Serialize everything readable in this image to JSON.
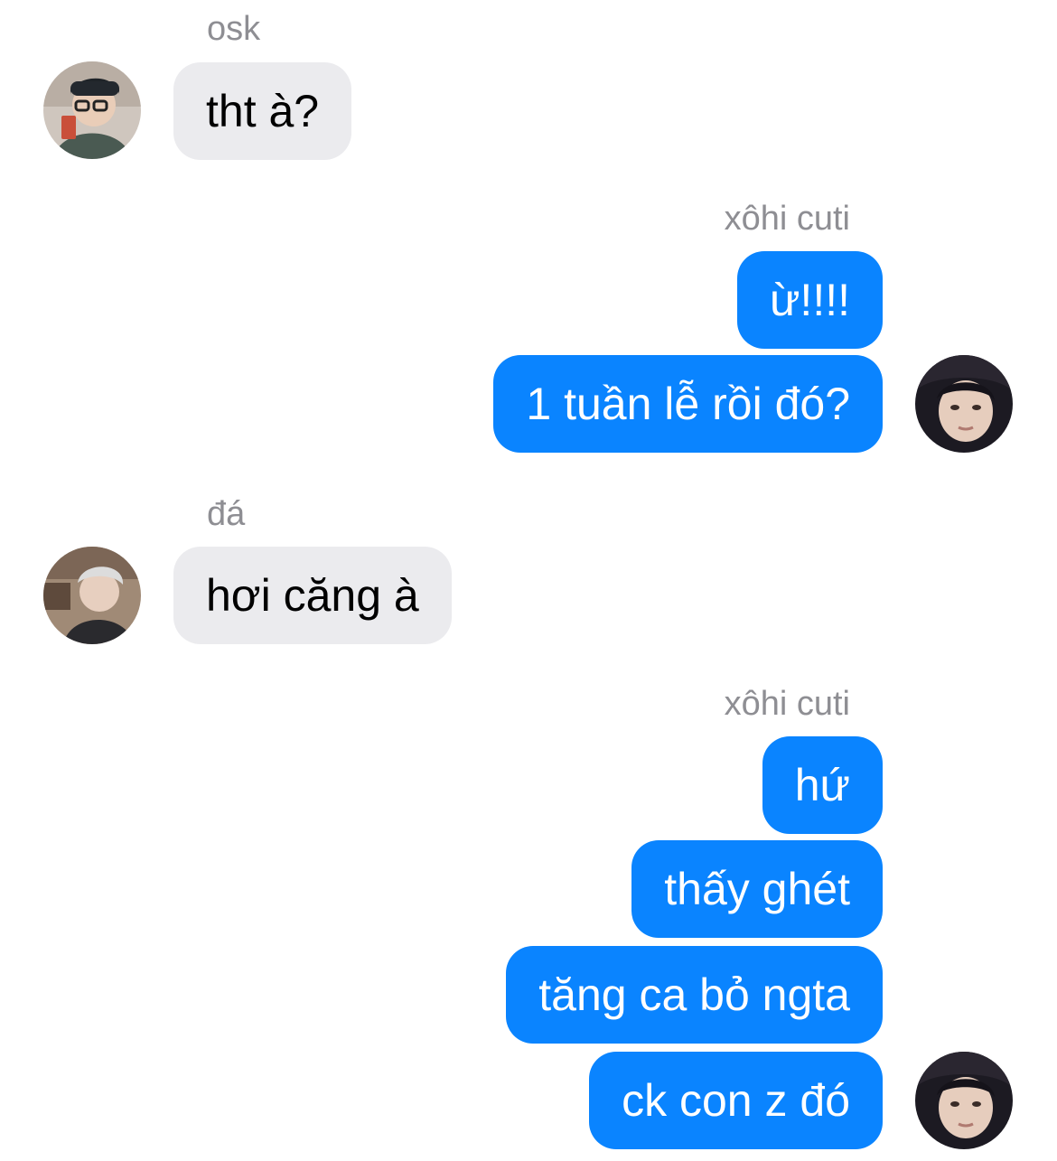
{
  "colors": {
    "incoming_bubble": "#ebebee",
    "outgoing_bubble": "#0a84ff",
    "sender_label": "#8e8e93"
  },
  "groups": [
    {
      "sender": "osk",
      "direction": "incoming",
      "messages": [
        "tht à?"
      ]
    },
    {
      "sender": "xôhi cuti",
      "direction": "outgoing",
      "messages": [
        "ừ!!!!",
        "1 tuần lễ rồi đó?"
      ]
    },
    {
      "sender": "đá",
      "direction": "incoming",
      "messages": [
        "hơi căng à"
      ]
    },
    {
      "sender": "xôhi cuti",
      "direction": "outgoing",
      "messages": [
        "hứ",
        "thấy ghét",
        "tăng ca bỏ ngta",
        "ck con z đó"
      ]
    }
  ]
}
